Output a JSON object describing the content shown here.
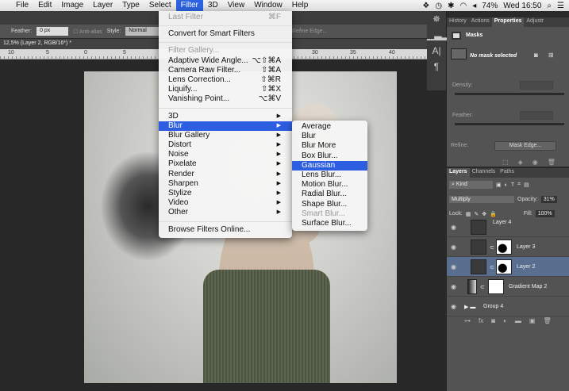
{
  "menubar": {
    "items": [
      "File",
      "Edit",
      "Image",
      "Layer",
      "Type",
      "Select",
      "Filter",
      "3D",
      "View",
      "Window",
      "Help"
    ],
    "active": "Filter",
    "battery": "74%",
    "clock": "Wed 16:50"
  },
  "options": {
    "feather_label": "Feather:",
    "feather_value": "0 px",
    "antialias": "Anti-alias",
    "style_label": "Style:",
    "style_value": "Normal",
    "refine": "Refine Edge..."
  },
  "document": {
    "tab": "12,5% (Layer 2, RGB/16*) *",
    "ruler": [
      "10",
      "5",
      "0",
      "5",
      "30",
      "35",
      "40"
    ]
  },
  "filter_menu": [
    {
      "label": "Last Filter",
      "shortcut": "⌘F",
      "disabled": true
    },
    {
      "sep": true
    },
    {
      "label": "Convert for Smart Filters"
    },
    {
      "sep": true
    },
    {
      "label": "Filter Gallery...",
      "disabled": true
    },
    {
      "label": "Adaptive Wide Angle...",
      "shortcut": "⌥⇧⌘A"
    },
    {
      "label": "Camera Raw Filter...",
      "shortcut": "⇧⌘A"
    },
    {
      "label": "Lens Correction...",
      "shortcut": "⇧⌘R"
    },
    {
      "label": "Liquify...",
      "shortcut": "⇧⌘X"
    },
    {
      "label": "Vanishing Point...",
      "shortcut": "⌥⌘V"
    },
    {
      "sep": true
    },
    {
      "label": "3D",
      "sub": true
    },
    {
      "label": "Blur",
      "sub": true,
      "highlight": true
    },
    {
      "label": "Blur Gallery",
      "sub": true
    },
    {
      "label": "Distort",
      "sub": true
    },
    {
      "label": "Noise",
      "sub": true
    },
    {
      "label": "Pixelate",
      "sub": true
    },
    {
      "label": "Render",
      "sub": true
    },
    {
      "label": "Sharpen",
      "sub": true
    },
    {
      "label": "Stylize",
      "sub": true
    },
    {
      "label": "Video",
      "sub": true
    },
    {
      "label": "Other",
      "sub": true
    },
    {
      "sep": true
    },
    {
      "label": "Browse Filters Online..."
    }
  ],
  "blur_menu": [
    {
      "label": "Average"
    },
    {
      "label": "Blur"
    },
    {
      "label": "Blur More"
    },
    {
      "label": "Box Blur..."
    },
    {
      "label": "Gaussian Blur...",
      "highlight": true
    },
    {
      "label": "Lens Blur..."
    },
    {
      "label": "Motion Blur..."
    },
    {
      "label": "Radial Blur..."
    },
    {
      "label": "Shape Blur..."
    },
    {
      "label": "Smart Blur...",
      "disabled": true
    },
    {
      "label": "Surface Blur..."
    }
  ],
  "properties": {
    "tabs": [
      "History",
      "Actions",
      "Properties",
      "Adjustr"
    ],
    "active": "Properties",
    "title": "Masks",
    "no_mask": "No mask selected",
    "density": "Density:",
    "feather": "Feather:",
    "refine": "Refine:",
    "mask_edge": "Mask Edge..."
  },
  "layers": {
    "tabs": [
      "Layers",
      "Channels",
      "Paths"
    ],
    "active": "Layers",
    "kind": "Kind",
    "blend": "Multiply",
    "opacity_label": "Opacity:",
    "opacity": "31%",
    "lock": "Lock:",
    "fill_label": "Fill:",
    "fill": "100%",
    "items": [
      {
        "name": "Layer 4"
      },
      {
        "name": "Layer 3",
        "mask": true
      },
      {
        "name": "Layer 2",
        "mask": true,
        "selected": true
      },
      {
        "name": "Gradient Map 2",
        "adj": true
      },
      {
        "name": "Group 4",
        "group": true
      }
    ]
  }
}
